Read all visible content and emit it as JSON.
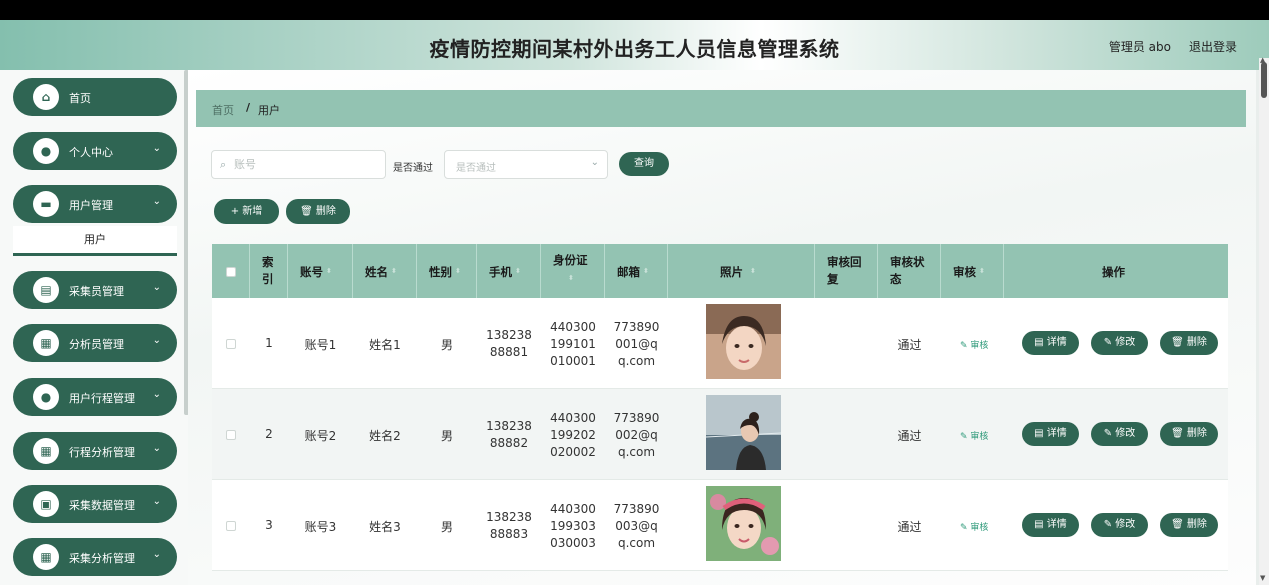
{
  "header": {
    "title": "疫情防控期间某村外出务工人员信息管理系统",
    "admin_label": "管理员 abo",
    "logout_label": "退出登录"
  },
  "sidebar": {
    "items": [
      {
        "label": "首页",
        "icon": "home-icon",
        "glyph": "⌂"
      },
      {
        "label": "个人中心",
        "icon": "user-icon",
        "glyph": "●"
      },
      {
        "label": "用户管理",
        "icon": "ticket-icon",
        "glyph": "▬"
      },
      {
        "label": "采集员管理",
        "icon": "chart-icon",
        "glyph": "▤"
      },
      {
        "label": "分析员管理",
        "icon": "grid-icon",
        "glyph": "▦"
      },
      {
        "label": "用户行程管理",
        "icon": "person-icon",
        "glyph": "●"
      },
      {
        "label": "行程分析管理",
        "icon": "grid-icon",
        "glyph": "▦"
      },
      {
        "label": "采集数据管理",
        "icon": "clipboard-icon",
        "glyph": "▣"
      },
      {
        "label": "采集分析管理",
        "icon": "grid-icon",
        "glyph": "▦"
      }
    ],
    "submenu_label": "用户"
  },
  "breadcrumb": {
    "home": "首页",
    "separator": "/",
    "current": "用户"
  },
  "search": {
    "account_placeholder": "账号",
    "approve_label": "是否通过",
    "approve_placeholder": "是否通过",
    "query_label": "查询"
  },
  "actions": {
    "add_label": "+ 新增",
    "delete_label": "🗑 删除"
  },
  "table": {
    "headers": [
      "索引",
      "账号",
      "姓名",
      "性别",
      "手机",
      "身份证",
      "邮箱",
      "照片",
      "审核回复",
      "审核状态",
      "审核",
      "操作"
    ],
    "rows": [
      {
        "index": "1",
        "account": "账号1",
        "name": "姓名1",
        "gender": "男",
        "phone": [
          "138238",
          "88881"
        ],
        "id_card": [
          "440300",
          "199101",
          "010001"
        ],
        "email": [
          "773890",
          "001@q",
          "q.com"
        ],
        "reply": "",
        "status": "通过",
        "audit": "✎ 审核"
      },
      {
        "index": "2",
        "account": "账号2",
        "name": "姓名2",
        "gender": "男",
        "phone": [
          "138238",
          "88882"
        ],
        "id_card": [
          "440300",
          "199202",
          "020002"
        ],
        "email": [
          "773890",
          "002@q",
          "q.com"
        ],
        "reply": "",
        "status": "通过",
        "audit": "✎ 审核"
      },
      {
        "index": "3",
        "account": "账号3",
        "name": "姓名3",
        "gender": "男",
        "phone": [
          "138238",
          "88883"
        ],
        "id_card": [
          "440300",
          "199303",
          "030003"
        ],
        "email": [
          "773890",
          "003@q",
          "q.com"
        ],
        "reply": "",
        "status": "通过",
        "audit": "✎ 审核"
      }
    ],
    "row_actions": {
      "detail": "▤ 详情",
      "edit": "✎ 修改",
      "delete": "🗑 删除"
    }
  },
  "colors": {
    "primary": "#2f6553",
    "header_bg": "#93c3b2",
    "accent": "#2f9a7a"
  }
}
